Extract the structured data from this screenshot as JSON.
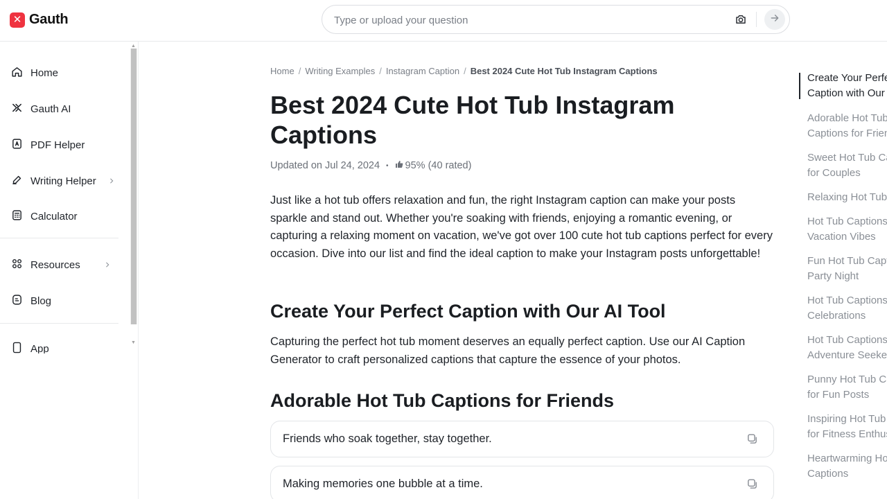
{
  "app": {
    "name": "Gauth",
    "brand_color": "#ef3340",
    "logo_glyph": "✕"
  },
  "search": {
    "placeholder": "Type or upload your question",
    "value": ""
  },
  "icons": {
    "camera": "camera-icon",
    "submit": "arrow-right-icon",
    "copy": "copy-icon",
    "thumb": "thumbs-up-icon"
  },
  "sidebar": {
    "items": [
      {
        "label": "Home",
        "icon": "home-icon"
      },
      {
        "label": "Gauth AI",
        "icon": "gauth-ai-icon"
      },
      {
        "label": "PDF Helper",
        "icon": "pdf-icon"
      },
      {
        "label": "Writing Helper",
        "icon": "pen-icon",
        "has_submenu": true
      },
      {
        "label": "Calculator",
        "icon": "calculator-icon"
      },
      {
        "label": "Resources",
        "icon": "grid-icon",
        "has_submenu": true
      },
      {
        "label": "Blog",
        "icon": "blog-icon"
      },
      {
        "label": "App",
        "icon": "phone-icon"
      }
    ]
  },
  "breadcrumb": {
    "items": [
      "Home",
      "Writing Examples",
      "Instagram Caption"
    ],
    "current": "Best 2024 Cute Hot Tub Instagram Captions",
    "separator": "/"
  },
  "article": {
    "title": "Best 2024 Cute Hot Tub Instagram Captions",
    "updated": "Updated on Jul 24, 2024",
    "bullet": "•",
    "rating": "95% (40 rated)",
    "intro": "Just like a hot tub offers relaxation and fun, the right Instagram caption can make your posts sparkle and stand out. Whether you're soaking with friends, enjoying a romantic evening, or capturing a relaxing moment on vacation, we've got over 100 cute hot tub captions perfect for every occasion. Dive into our list and find the ideal caption to make your Instagram posts unforgettable!",
    "section1": {
      "heading": "Create Your Perfect Caption with Our AI Tool",
      "text": "Capturing the perfect hot tub moment deserves an equally perfect caption. Use our AI Caption Generator to craft personalized captions that capture the essence of your photos."
    },
    "section2": {
      "heading": "Adorable Hot Tub Captions for Friends",
      "captions": [
        "Friends who soak together, stay together.",
        "Making memories one bubble at a time."
      ]
    }
  },
  "toc": {
    "items": [
      {
        "label": "Create Your Perfect Caption with Our AI Tool",
        "active": true
      },
      {
        "label": "Adorable Hot Tub Captions for Friends"
      },
      {
        "label": "Sweet Hot Tub Captions for Couples"
      },
      {
        "label": "Relaxing Hot Tub Captions"
      },
      {
        "label": "Hot Tub Captions for Vacation Vibes"
      },
      {
        "label": "Fun Hot Tub Captions for Party Night"
      },
      {
        "label": "Hot Tub Captions for Celebrations"
      },
      {
        "label": "Hot Tub Captions for Adventure Seekers"
      },
      {
        "label": "Punny Hot Tub Captions for Fun Posts"
      },
      {
        "label": "Inspiring Hot Tub Captions for Fitness Enthusiasts"
      },
      {
        "label": "Heartwarming Hot Tub Captions"
      }
    ]
  }
}
